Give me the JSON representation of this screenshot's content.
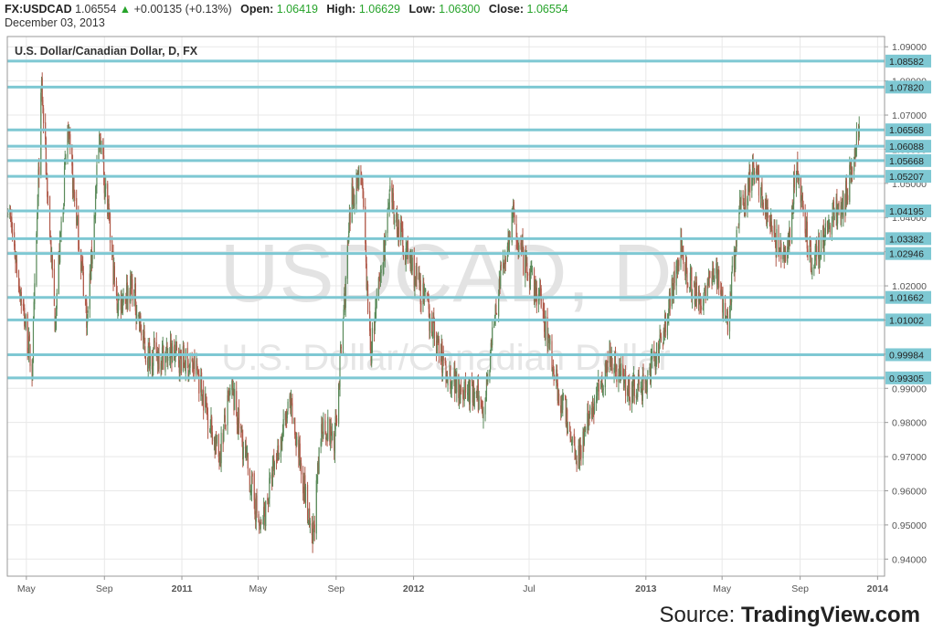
{
  "header": {
    "symbol": "FX:USDCAD",
    "price": "1.06554",
    "arrow": "▲",
    "change": "+0.00135 (+0.13%)",
    "open_label": "Open:",
    "open": "1.06419",
    "high_label": "High:",
    "high": "1.06629",
    "low_label": "Low:",
    "low": "1.06300",
    "close_label": "Close:",
    "close": "1.06554",
    "date": "December 03, 2013"
  },
  "source": {
    "prefix": "Source:",
    "brand": "TradingView.com"
  },
  "colors": {
    "level_line": "#7ec8d3",
    "level_label_bg": "#7ec8d3",
    "up": "#26a32a",
    "candle_up": "#5a8a5a",
    "candle_down": "#b05a4a",
    "grid": "#e8e8e8"
  },
  "chart_data": {
    "type": "candlestick",
    "title": "U.S. Dollar/Canadian Dollar, D, FX",
    "watermark_main": "USDCAD, D",
    "watermark_sub": "U.S. Dollar/Canadian Dollar",
    "ylim": [
      0.935,
      1.093
    ],
    "xlim": [
      "2010-04-01",
      "2014-01-12"
    ],
    "y_ticks": [
      "1.09000",
      "1.08000",
      "1.07000",
      "1.06000",
      "1.05000",
      "1.04000",
      "1.03000",
      "1.02000",
      "1.01000",
      "1.00000",
      "0.99000",
      "0.98000",
      "0.97000",
      "0.96000",
      "0.95000",
      "0.94000"
    ],
    "x_ticks": [
      {
        "label": "May",
        "date": "2010-05-01",
        "bold": false
      },
      {
        "label": "Sep",
        "date": "2010-09-01",
        "bold": false
      },
      {
        "label": "2011",
        "date": "2011-01-01",
        "bold": true
      },
      {
        "label": "May",
        "date": "2011-05-01",
        "bold": false
      },
      {
        "label": "Sep",
        "date": "2011-09-01",
        "bold": false
      },
      {
        "label": "2012",
        "date": "2012-01-01",
        "bold": true
      },
      {
        "label": "Jul",
        "date": "2012-07-01",
        "bold": false
      },
      {
        "label": "2013",
        "date": "2013-01-01",
        "bold": true
      },
      {
        "label": "May",
        "date": "2013-05-01",
        "bold": false
      },
      {
        "label": "Sep",
        "date": "2013-09-01",
        "bold": false
      },
      {
        "label": "2014",
        "date": "2014-01-01",
        "bold": true
      }
    ],
    "levels": [
      "1.08582",
      "1.07820",
      "1.06568",
      "1.06088",
      "1.05668",
      "1.05207",
      "1.04195",
      "1.03382",
      "1.02946",
      "1.01662",
      "1.01002",
      "0.99984",
      "0.99305"
    ],
    "price_path": [
      [
        "2010-04-01",
        1.045
      ],
      [
        "2010-05-10",
        0.995
      ],
      [
        "2010-05-25",
        1.078
      ],
      [
        "2010-06-15",
        1.01
      ],
      [
        "2010-07-05",
        1.065
      ],
      [
        "2010-08-05",
        1.01
      ],
      [
        "2010-08-25",
        1.065
      ],
      [
        "2010-09-20",
        1.015
      ],
      [
        "2010-10-15",
        1.02
      ],
      [
        "2010-11-05",
        1.0
      ],
      [
        "2010-12-20",
        1.0
      ],
      [
        "2011-01-25",
        0.995
      ],
      [
        "2011-02-28",
        0.97
      ],
      [
        "2011-03-20",
        0.99
      ],
      [
        "2011-05-05",
        0.948
      ],
      [
        "2011-05-30",
        0.97
      ],
      [
        "2011-06-20",
        0.985
      ],
      [
        "2011-07-10",
        0.965
      ],
      [
        "2011-07-25",
        0.943
      ],
      [
        "2011-08-10",
        0.98
      ],
      [
        "2011-08-30",
        0.975
      ],
      [
        "2011-09-25",
        1.045
      ],
      [
        "2011-10-10",
        1.055
      ],
      [
        "2011-10-25",
        1.0
      ],
      [
        "2011-11-25",
        1.045
      ],
      [
        "2011-12-20",
        1.03
      ],
      [
        "2012-01-20",
        1.015
      ],
      [
        "2012-02-20",
        0.995
      ],
      [
        "2012-03-20",
        0.99
      ],
      [
        "2012-04-20",
        0.985
      ],
      [
        "2012-05-15",
        1.02
      ],
      [
        "2012-06-05",
        1.04
      ],
      [
        "2012-06-25",
        1.025
      ],
      [
        "2012-07-20",
        1.015
      ],
      [
        "2012-08-15",
        0.99
      ],
      [
        "2012-09-15",
        0.97
      ],
      [
        "2012-10-10",
        0.985
      ],
      [
        "2012-11-05",
        1.0
      ],
      [
        "2012-12-05",
        0.99
      ],
      [
        "2012-12-25",
        0.99
      ],
      [
        "2013-01-20",
        1.0
      ],
      [
        "2013-02-25",
        1.03
      ],
      [
        "2013-03-25",
        1.015
      ],
      [
        "2013-04-20",
        1.025
      ],
      [
        "2013-05-10",
        1.01
      ],
      [
        "2013-05-28",
        1.04
      ],
      [
        "2013-06-20",
        1.055
      ],
      [
        "2013-07-20",
        1.035
      ],
      [
        "2013-08-10",
        1.025
      ],
      [
        "2013-08-25",
        1.055
      ],
      [
        "2013-09-20",
        1.025
      ],
      [
        "2013-10-20",
        1.04
      ],
      [
        "2013-11-10",
        1.045
      ],
      [
        "2013-12-03",
        1.0655
      ]
    ]
  }
}
